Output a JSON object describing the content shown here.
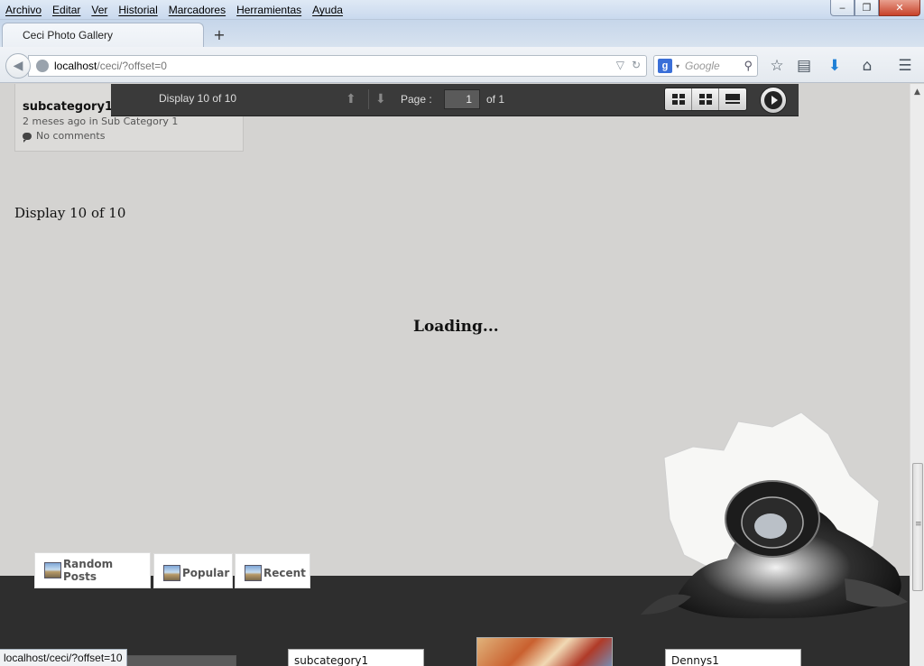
{
  "menu": {
    "items": [
      "Archivo",
      "Editar",
      "Ver",
      "Historial",
      "Marcadores",
      "Herramientas",
      "Ayuda"
    ]
  },
  "window": {
    "minimize": "‒",
    "maximize": "❐",
    "close": "✕"
  },
  "tab": {
    "title": "Ceci Photo Gallery",
    "new_tab": "+"
  },
  "address": {
    "host": "localhost",
    "path": "/ceci/?offset=0"
  },
  "search": {
    "engine_letter": "g",
    "placeholder": "Google"
  },
  "toolbar_icons": [
    "star-icon",
    "reading-list-icon",
    "download-icon",
    "home-icon",
    "menu-icon"
  ],
  "post_card": {
    "title": "subcategory1",
    "meta": "2 meses ago in Sub Category 1",
    "comments": "No comments"
  },
  "pager": {
    "count_text": "Display 10 of 10",
    "page_label": "Page :",
    "page_value": "1",
    "of_text": "of 1"
  },
  "main": {
    "display_text": "Display 10 of 10",
    "loading_text": "Loading..."
  },
  "footer_tabs": [
    "Random Posts",
    "Popular",
    "Recent"
  ],
  "footer_thumbs": [
    {
      "label": "subcategory1"
    },
    {
      "label": "Dennys1"
    }
  ],
  "status_bar": {
    "link": "localhost/ceci/?offset=10"
  },
  "colors": {
    "page_bg": "#d4d3d1",
    "pager_bar": "#3a3a3a",
    "footer": "#2e2e2e"
  }
}
